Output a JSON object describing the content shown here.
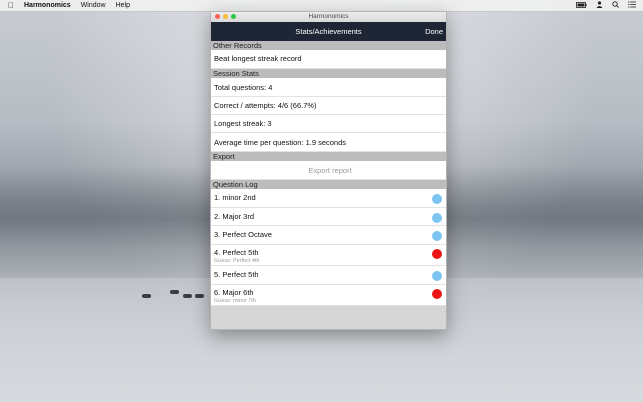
{
  "menubar": {
    "apple": "",
    "app_name": "Harmonomics",
    "items": [
      "Window",
      "Help"
    ]
  },
  "window": {
    "title": "Harmonomics",
    "nav_title": "Stats/Achievements",
    "done_label": "Done"
  },
  "sections": {
    "other_records": "Other Records",
    "session_stats": "Session Stats",
    "export": "Export",
    "question_log": "Question Log"
  },
  "other_records": [
    "Beat longest streak record"
  ],
  "session_stats": [
    "Total questions: 4",
    "Correct / attempts: 4/6 (66.7%)",
    "Longest streak: 3",
    "Average time per question: 1.9 seconds"
  ],
  "export_label": "Export report",
  "question_log": [
    {
      "label": "1. minor 2nd",
      "guess": "",
      "status": "correct"
    },
    {
      "label": "2. Major 3rd",
      "guess": "",
      "status": "correct"
    },
    {
      "label": "3. Perfect Octave",
      "guess": "",
      "status": "correct"
    },
    {
      "label": "4. Perfect 5th",
      "guess": "Guess: Perfect 4th",
      "status": "wrong"
    },
    {
      "label": "5. Perfect 5th",
      "guess": "",
      "status": "correct"
    },
    {
      "label": "6. Major 6th",
      "guess": "Guess: minor 7th",
      "status": "wrong"
    }
  ],
  "colors": {
    "correct": "#7cc4f2",
    "wrong": "#f01515",
    "navbar": "#1e2636",
    "close": "#fc5f57",
    "minimize": "#fdbc2e",
    "zoom": "#28c840"
  }
}
